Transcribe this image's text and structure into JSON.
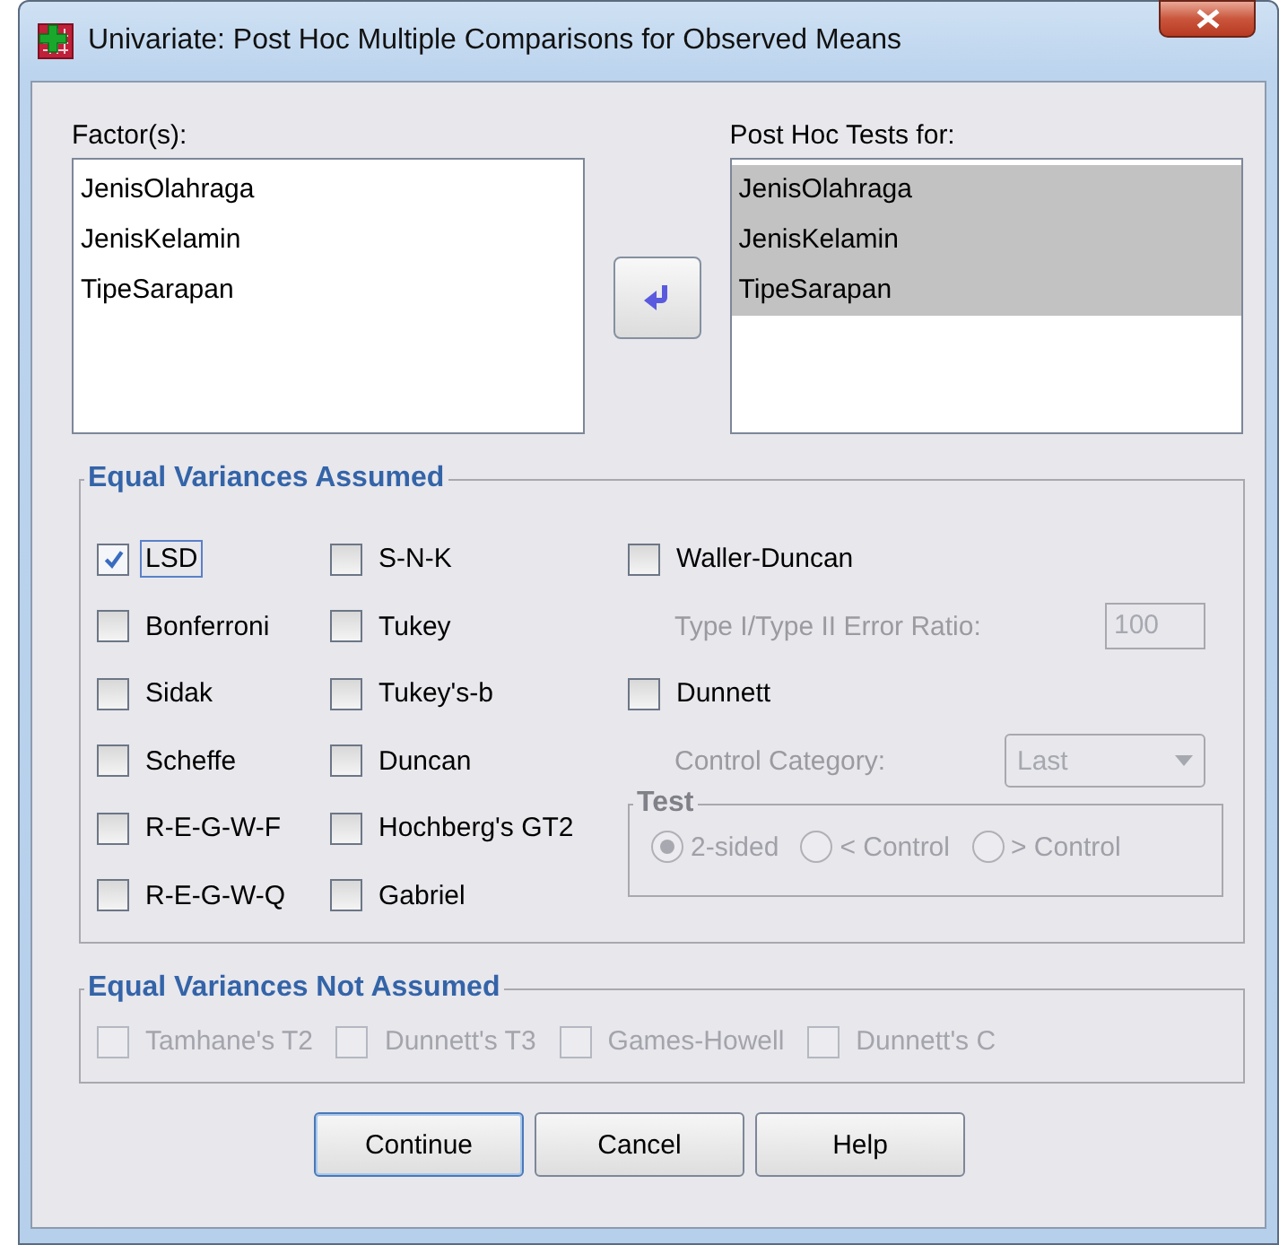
{
  "window": {
    "title": "Univariate: Post Hoc Multiple Comparisons for Observed Means"
  },
  "factors": {
    "label": "Factor(s):",
    "items": [
      "JenisOlahraga",
      "JenisKelamin",
      "TipeSarapan"
    ]
  },
  "post_hoc": {
    "label": "Post Hoc Tests for:",
    "items": [
      {
        "text": "JenisOlahraga",
        "selected": true
      },
      {
        "text": "JenisKelamin",
        "selected": true
      },
      {
        "text": "TipeSarapan",
        "selected": true
      }
    ]
  },
  "equal_assumed": {
    "title": "Equal Variances Assumed",
    "columns": [
      [
        {
          "kind": "checkbox",
          "label": "LSD",
          "checked": true,
          "focused": true
        },
        {
          "kind": "checkbox",
          "label": "Bonferroni",
          "checked": false,
          "focused": false
        },
        {
          "kind": "checkbox",
          "label": "Sidak",
          "checked": false,
          "focused": false
        },
        {
          "kind": "checkbox",
          "label": "Scheffe",
          "checked": false,
          "focused": false
        },
        {
          "kind": "checkbox",
          "label": "R-E-G-W-F",
          "checked": false,
          "focused": false
        },
        {
          "kind": "checkbox",
          "label": "R-E-G-W-Q",
          "checked": false,
          "focused": false
        }
      ],
      [
        {
          "kind": "checkbox",
          "label": "S-N-K",
          "checked": false,
          "focused": false
        },
        {
          "kind": "checkbox",
          "label": "Tukey",
          "checked": false,
          "focused": false
        },
        {
          "kind": "checkbox",
          "label": "Tukey's-b",
          "checked": false,
          "focused": false
        },
        {
          "kind": "checkbox",
          "label": "Duncan",
          "checked": false,
          "focused": false
        },
        {
          "kind": "checkbox",
          "label": "Hochberg's GT2",
          "checked": false,
          "focused": false
        },
        {
          "kind": "checkbox",
          "label": "Gabriel",
          "checked": false,
          "focused": false
        }
      ],
      [
        {
          "kind": "checkbox",
          "label": "Waller-Duncan",
          "checked": false,
          "focused": false
        },
        {
          "kind": "field",
          "label": "Type I/Type II Error Ratio:",
          "value": "100",
          "disabled": true
        },
        {
          "kind": "checkbox",
          "label": "Dunnett",
          "checked": false,
          "focused": false
        },
        {
          "kind": "dropdown",
          "label": "Control Category:",
          "value": "Last",
          "disabled": true
        },
        {
          "kind": "radiogroup",
          "title": "Test",
          "disabled": true,
          "options": [
            {
              "label": "2-sided",
              "selected": true
            },
            {
              "label": "< Control",
              "selected": false
            },
            {
              "label": "> Control",
              "selected": false
            }
          ]
        }
      ]
    ]
  },
  "not_assumed": {
    "title": "Equal Variances Not Assumed",
    "items": [
      {
        "label": "Tamhane's T2",
        "checked": false,
        "disabled": true
      },
      {
        "label": "Dunnett's T3",
        "checked": false,
        "disabled": true
      },
      {
        "label": "Games-Howell",
        "checked": false,
        "disabled": true
      },
      {
        "label": "Dunnett's C",
        "checked": false,
        "disabled": true
      }
    ]
  },
  "buttons": [
    {
      "label": "Continue",
      "default": true
    },
    {
      "label": "Cancel",
      "default": false
    },
    {
      "label": "Help",
      "default": false
    }
  ]
}
